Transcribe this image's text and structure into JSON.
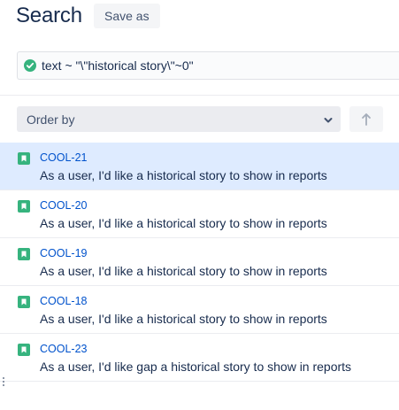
{
  "header": {
    "title": "Search",
    "save_label": "Save as"
  },
  "query": {
    "value": "text ~ \"\\\"historical story\\\"~0\"",
    "status_icon": "check-circle-icon",
    "status_color": "#36b37e"
  },
  "sort": {
    "order_label": "Order by",
    "direction_icon": "arrow-up-icon"
  },
  "colors": {
    "accent": "#0052cc",
    "selected_row": "#deebff",
    "story_icon": "#36b37e"
  },
  "issues": [
    {
      "key": "COOL-21",
      "summary": "As a user, I'd like a historical story to show in reports",
      "selected": true
    },
    {
      "key": "COOL-20",
      "summary": "As a user, I'd like a historical story to show in reports",
      "selected": false
    },
    {
      "key": "COOL-19",
      "summary": "As a user, I'd like a historical story to show in reports",
      "selected": false
    },
    {
      "key": "COOL-18",
      "summary": "As a user, I'd like a historical story to show in reports",
      "selected": false
    },
    {
      "key": "COOL-23",
      "summary": "As a user, I'd like gap a historical story to show in reports",
      "selected": false
    }
  ]
}
